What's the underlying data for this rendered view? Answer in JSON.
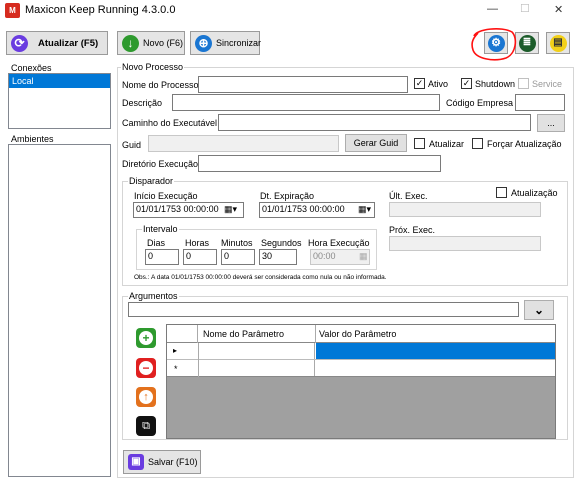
{
  "window": {
    "title": "Maxicon Keep Running 4.3.0.0",
    "minimize": "—",
    "maximize": "☐",
    "close": "✕"
  },
  "toolbar": {
    "refresh_label": "Atualizar (F5)",
    "new_label": "Novo (F6)",
    "sync_label": "Sincronizar"
  },
  "sidebar": {
    "connections_title": "Conexões",
    "connections": [
      "Local"
    ],
    "environments_title": "Ambientes"
  },
  "form": {
    "section_title": "Novo Processo",
    "process_name_label": "Nome do Processo",
    "process_name_value": "",
    "active_label": "Ativo",
    "active_checked": true,
    "shutdown_label": "Shutdown",
    "shutdown_checked": true,
    "service_label": "Service",
    "description_label": "Descrição",
    "company_code_label": "Código Empresa",
    "executable_path_label": "Caminho do Executável",
    "browse_label": "...",
    "guid_label": "Guid",
    "generate_guid_label": "Gerar Guid",
    "update_label": "Atualizar",
    "force_update_label": "Forçar Atualização",
    "exec_dir_label": "Diretório Execução"
  },
  "trigger": {
    "title": "Disparador",
    "start_label": "Início Execução",
    "start_value": "01/01/1753 00:00:00",
    "expiration_label": "Dt. Expiração",
    "expiration_value": "01/01/1753 00:00:00",
    "last_exec_label": "Últ. Exec.",
    "update_label": "Atualização",
    "next_exec_label": "Próx. Exec.",
    "interval_title": "Intervalo",
    "days_label": "Dias",
    "days_value": "0",
    "hours_label": "Horas",
    "hours_value": "0",
    "minutes_label": "Minutos",
    "minutes_value": "0",
    "seconds_label": "Segundos",
    "seconds_value": "30",
    "exec_time_label": "Hora Execução",
    "exec_time_value": "00:00",
    "note": "Obs.: A data 01/01/1753 00:00:00 deverá ser considerada como nula ou não informada."
  },
  "arguments": {
    "title": "Argumentos",
    "columns": [
      "Nome do Parâmetro",
      "Valor do Parâmetro"
    ],
    "rows": [
      {
        "marker": "▸",
        "name": "",
        "value": ""
      },
      {
        "marker": "*",
        "name": "",
        "value": ""
      }
    ]
  },
  "footer": {
    "save_label": "Salvar (F10)"
  },
  "colors": {
    "accent_purple": "#6a3ce0",
    "green": "#2e9a2e",
    "blue": "#1a76d2",
    "dark_green": "#1c5c2a",
    "yellow": "#f2d019",
    "red": "#e02020",
    "orange": "#e3711d",
    "selection": "#0078d7",
    "annotation_red": "#ff1111"
  }
}
